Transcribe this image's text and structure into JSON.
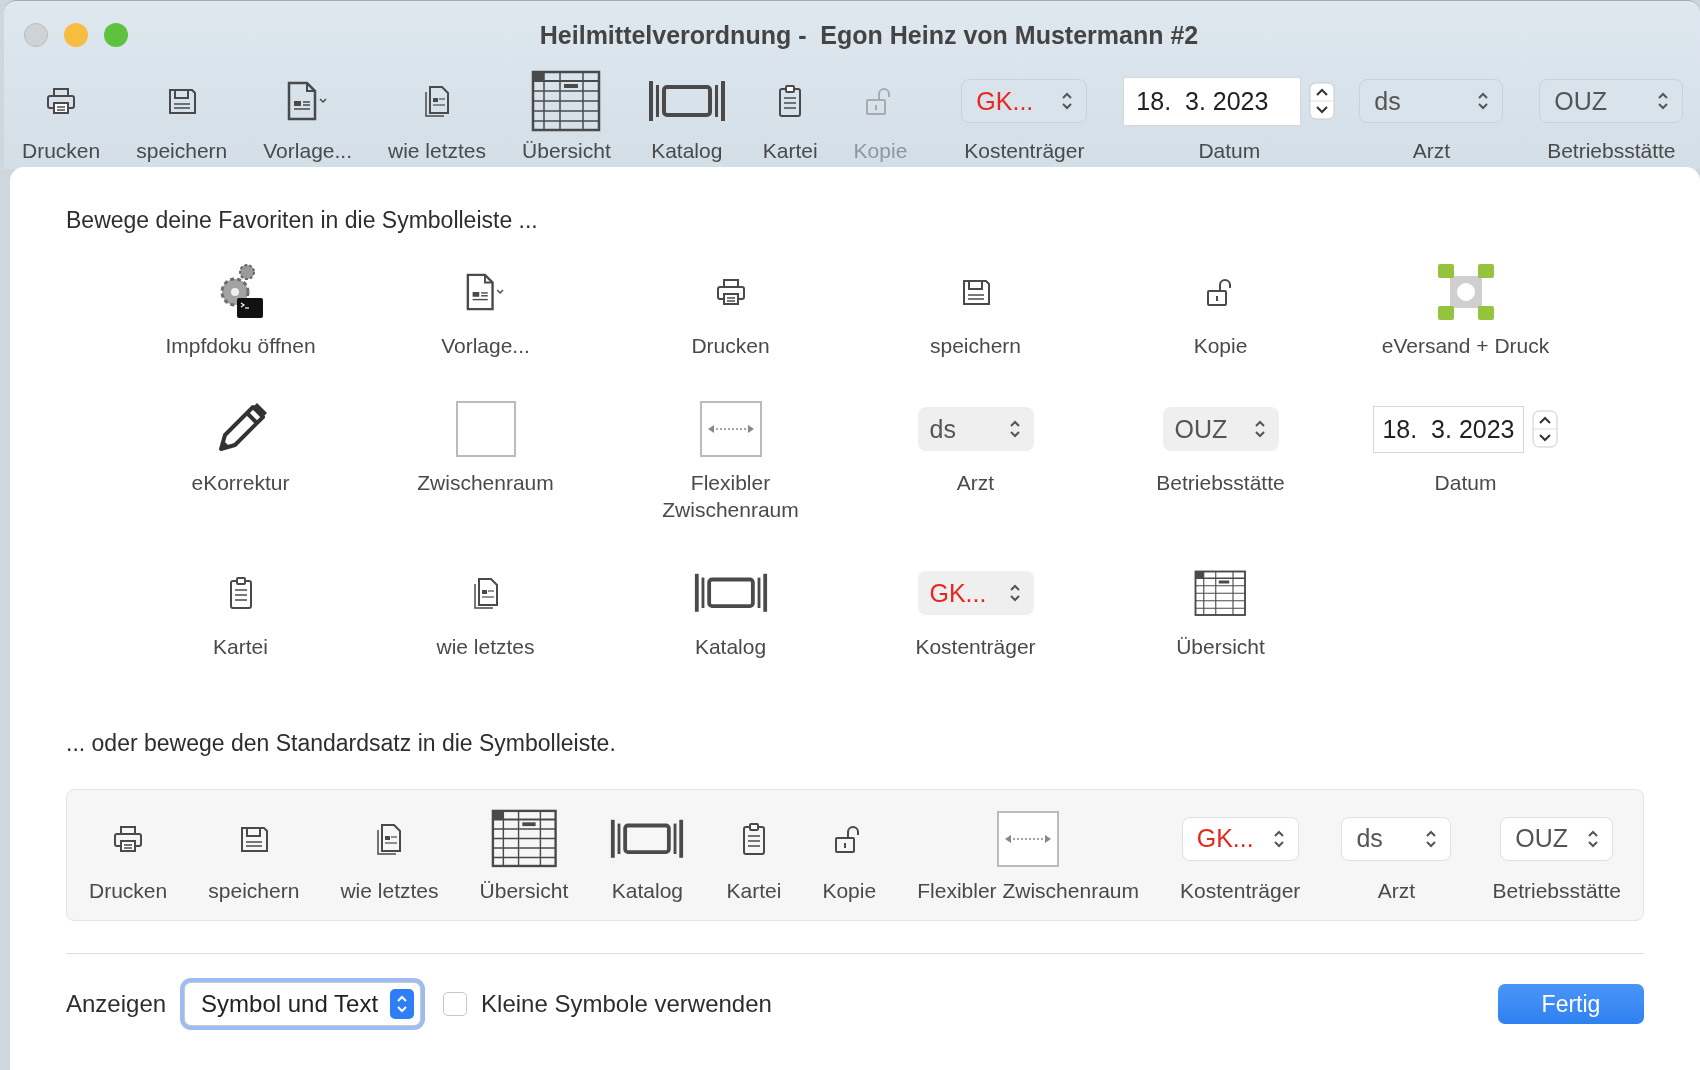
{
  "window": {
    "title": "Heilmittelverordnung -  Egon Heinz von Mustermann #2"
  },
  "toolbar": [
    {
      "kind": "printer",
      "label": "Drucken",
      "disabled": false
    },
    {
      "kind": "disk",
      "label": "speichern",
      "disabled": false
    },
    {
      "kind": "template",
      "label": "Vorlage...",
      "disabled": false
    },
    {
      "kind": "copy",
      "label": "wie letztes",
      "disabled": false
    },
    {
      "kind": "grid",
      "label": "Übersicht",
      "disabled": false
    },
    {
      "kind": "catalog",
      "label": "Katalog",
      "disabled": false
    },
    {
      "kind": "clipboard",
      "label": "Kartei",
      "disabled": false
    },
    {
      "kind": "lock",
      "label": "Kopie",
      "disabled": true
    },
    {
      "kind": "separator"
    },
    {
      "kind": "popup",
      "value": "GK...",
      "warning": true,
      "label": "Kostenträger",
      "disabled": false
    },
    {
      "kind": "date",
      "value": "18.  3. 2023",
      "label": "Datum",
      "disabled": false
    },
    {
      "kind": "popup",
      "value": "ds",
      "warning": false,
      "label": "Arzt",
      "disabled": false
    },
    {
      "kind": "popup",
      "value": "OUZ",
      "warning": false,
      "label": "Betriebsstätte",
      "disabled": false
    }
  ],
  "favorites": {
    "heading": "Bewege deine Favoriten in die Symbolleiste ...",
    "items": [
      {
        "kind": "gears",
        "label": "Impfdoku öffnen"
      },
      {
        "kind": "template",
        "label": "Vorlage..."
      },
      {
        "kind": "printer",
        "label": "Drucken"
      },
      {
        "kind": "disk",
        "label": "speichern"
      },
      {
        "kind": "lock",
        "label": "Kopie"
      },
      {
        "kind": "squares",
        "label": "eVersand + Druck"
      },
      {
        "kind": "pencil",
        "label": "eKorrektur"
      },
      {
        "kind": "space",
        "label": "Zwischenraum"
      },
      {
        "kind": "flexspace",
        "label": "Flexibler Zwischenraum"
      },
      {
        "kind": "popup",
        "value": "ds",
        "warning": false,
        "label": "Arzt"
      },
      {
        "kind": "popup",
        "value": "OUZ",
        "warning": false,
        "label": "Betriebsstätte"
      },
      {
        "kind": "date",
        "value": "18.  3. 2023",
        "label": "Datum"
      },
      {
        "kind": "clipboard",
        "label": "Kartei"
      },
      {
        "kind": "copy",
        "label": "wie letztes"
      },
      {
        "kind": "catalog",
        "label": "Katalog"
      },
      {
        "kind": "popup",
        "value": "GK...",
        "warning": true,
        "label": "Kostenträger"
      },
      {
        "kind": "grid",
        "label": "Übersicht"
      }
    ]
  },
  "default_set": {
    "heading": "... oder bewege den Standardsatz in die Symbolleiste.",
    "items": [
      {
        "kind": "printer",
        "label": "Drucken"
      },
      {
        "kind": "disk",
        "label": "speichern"
      },
      {
        "kind": "copy",
        "label": "wie letztes"
      },
      {
        "kind": "grid",
        "label": "Übersicht"
      },
      {
        "kind": "catalog",
        "label": "Katalog"
      },
      {
        "kind": "clipboard",
        "label": "Kartei"
      },
      {
        "kind": "lock",
        "label": "Kopie"
      },
      {
        "kind": "flexspace",
        "label": "Flexibler Zwischenraum"
      },
      {
        "kind": "popup",
        "value": "GK...",
        "warning": true,
        "label": "Kostenträger"
      },
      {
        "kind": "popup",
        "value": "ds",
        "warning": false,
        "label": "Arzt"
      },
      {
        "kind": "popup",
        "value": "OUZ",
        "warning": false,
        "label": "Betriebsstätte"
      }
    ]
  },
  "footer": {
    "show_label": "Anzeigen",
    "show_value": "Symbol und Text",
    "small_icons": {
      "label": "Kleine Symbole verwenden",
      "checked": false
    },
    "done_button": "Fertig"
  }
}
